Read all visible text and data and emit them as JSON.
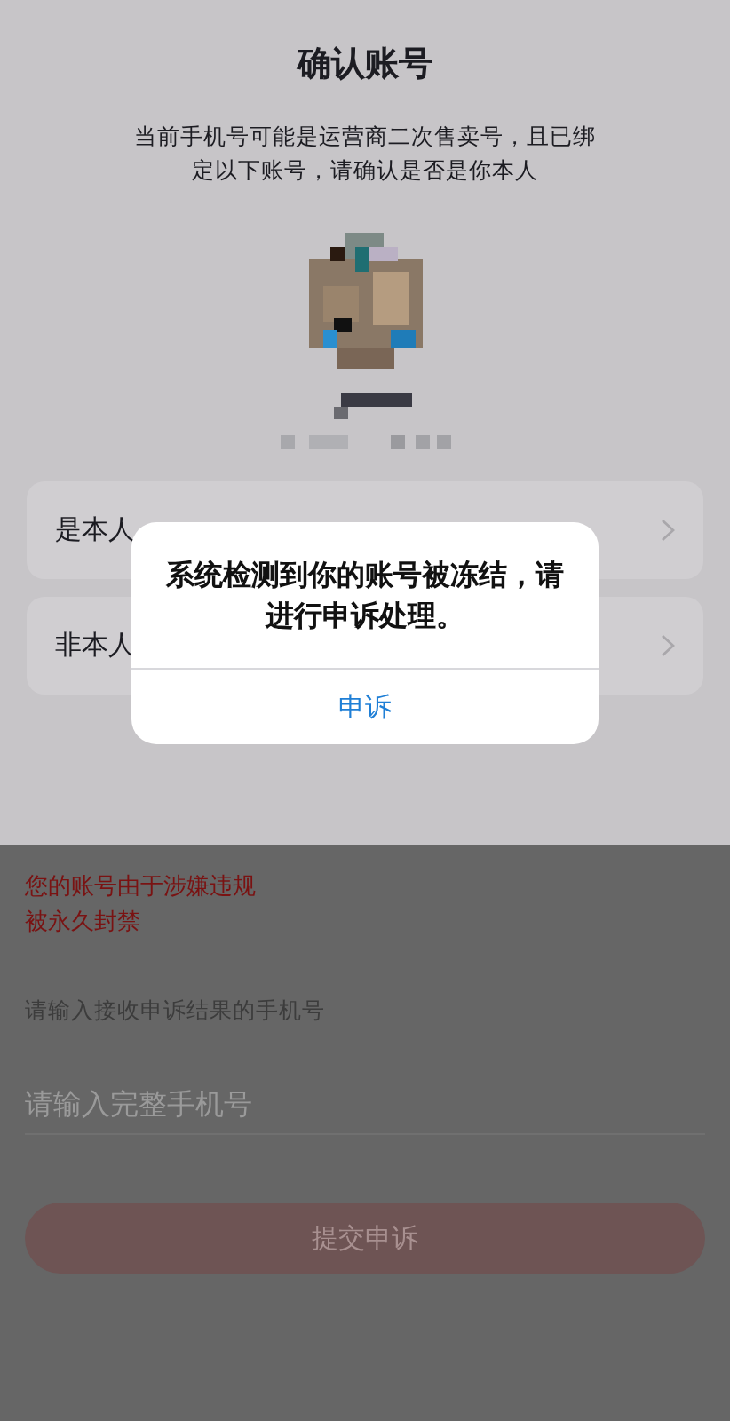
{
  "header": {
    "title": "确认账号",
    "description_lines": [
      "当前手机号可能是运营商二次售卖号，且已绑",
      "定以下账号，请确认是否是你本人"
    ]
  },
  "options": [
    {
      "label": "是本人"
    },
    {
      "label": "非本人"
    }
  ],
  "alert": {
    "message": "系统检测到你的账号被冻结，请进行申诉处理。",
    "button": "申诉"
  },
  "appeal": {
    "notice_lines": [
      "您的账号由于涉嫌违规",
      "被永久封禁"
    ],
    "phone_label": "请输入接收申诉结果的手机号",
    "phone_field": {
      "placeholder": "请输入完整手机号"
    },
    "submit": {
      "label": "提交申诉",
      "disabled": true
    }
  }
}
